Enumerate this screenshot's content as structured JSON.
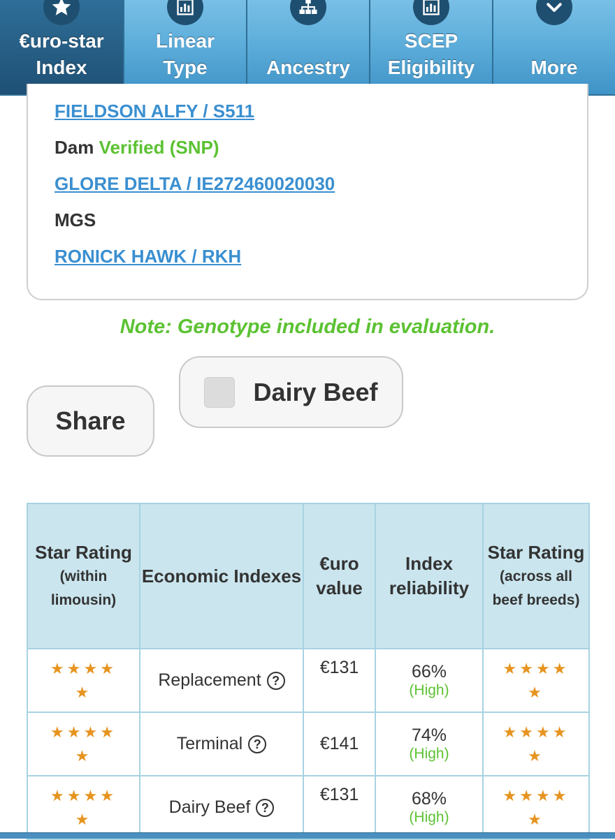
{
  "nav": {
    "tabs": [
      {
        "icon": "star-icon",
        "label_line1": "€uro-star",
        "label_line2": "Index",
        "active": true
      },
      {
        "icon": "bar-chart-icon",
        "label_line1": "Linear",
        "label_line2": "Type",
        "active": false
      },
      {
        "icon": "hierarchy-icon",
        "label_line1": "",
        "label_line2": "Ancestry",
        "active": false
      },
      {
        "icon": "bar-chart-icon",
        "label_line1": "SCEP",
        "label_line2": "Eligibility",
        "active": false
      },
      {
        "icon": "chevron-down-icon",
        "label_line1": "",
        "label_line2": "More",
        "active": false
      }
    ]
  },
  "pedigree": {
    "sire_link": "FIELDSON ALFY / S511",
    "dam_label": "Dam",
    "dam_status": "Verified (SNP)",
    "dam_link": "GLORE DELTA / IE272460020030",
    "mgs_label": "MGS",
    "mgs_link": "RONICK HAWK / RKH"
  },
  "note": "Note: Genotype included in evaluation.",
  "buttons": {
    "share": "Share",
    "dairy_beef": "Dairy Beef"
  },
  "table": {
    "headers": {
      "star_within_main": "Star Rating",
      "star_within_sub": "(within limousin)",
      "economic": "Economic Indexes",
      "euro": "€uro value",
      "reliability": "Index reliability",
      "star_across_main": "Star Rating",
      "star_across_sub": "(across all beef breeds)"
    },
    "rows": [
      {
        "index": "Replacement",
        "euro": "€131",
        "reliability": "66%",
        "rel_level": "(High)",
        "stars_within": 5,
        "stars_across": 5
      },
      {
        "index": "Terminal",
        "euro": "€141",
        "reliability": "74%",
        "rel_level": "(High)",
        "stars_within": 5,
        "stars_across": 5
      },
      {
        "index": "Dairy Beef",
        "euro": "€131",
        "reliability": "68%",
        "rel_level": "(High)",
        "stars_within": 5,
        "stars_across": 5
      }
    ],
    "help_glyph": "?",
    "star_glyph": "★"
  },
  "colors": {
    "nav_blue": "#5aa9d6",
    "nav_active": "#275f86",
    "link_blue": "#3a8fd0",
    "green": "#5cc233",
    "star_orange": "#e69420",
    "table_header": "#cae5ee"
  }
}
